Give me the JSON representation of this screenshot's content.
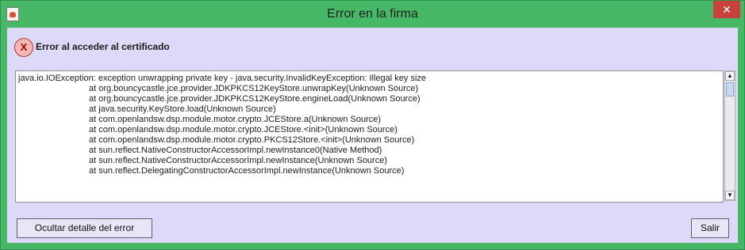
{
  "window": {
    "title": "Error en la firma",
    "close_glyph": "✕",
    "app_icon": "java-icon",
    "title_bar_color": "#46b866"
  },
  "header": {
    "icon": "error-x-icon",
    "icon_glyph": "X",
    "message": "Error al acceder al certificado"
  },
  "details": {
    "lines": [
      "java.io.IOException: exception unwrapping private key - java.security.InvalidKeyException: Illegal key size",
      "at org.bouncycastle.jce.provider.JDKPKCS12KeyStore.unwrapKey(Unknown Source)",
      "at org.bouncycastle.jce.provider.JDKPKCS12KeyStore.engineLoad(Unknown Source)",
      "at java.security.KeyStore.load(Unknown Source)",
      "at com.openlandsw.dsp.module.motor.crypto.JCEStore.a(Unknown Source)",
      "at com.openlandsw.dsp.module.motor.crypto.JCEStore.<init>(Unknown Source)",
      "at com.openlandsw.dsp.module.motor.crypto.PKCS12Store.<init>(Unknown Source)",
      "at sun.reflect.NativeConstructorAccessorImpl.newInstance0(Native Method)",
      "at sun.reflect.NativeConstructorAccessorImpl.newInstance(Unknown Source)",
      "at sun.reflect.DelegatingConstructorAccessorImpl.newInstance(Unknown Source)"
    ]
  },
  "scrollbar": {
    "up_glyph": "▲",
    "down_glyph": "▼"
  },
  "buttons": {
    "hide_details": "Ocultar detalle del error",
    "exit": "Salir"
  }
}
